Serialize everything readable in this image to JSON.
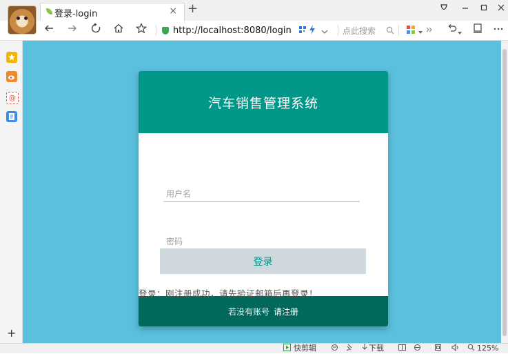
{
  "browser": {
    "tab_title": "登录-login",
    "tab_close": "×",
    "new_tab": "+",
    "address": "http://localhost:8080/login",
    "search_placeholder": "点此搜索",
    "zoom": "125%",
    "status": {
      "clip_label": "快剪辑",
      "download_label": "下载"
    }
  },
  "sidebar": {
    "add_label": "+"
  },
  "login": {
    "title": "汽车销售管理系统",
    "username_placeholder": "用户名",
    "password_placeholder": "密码",
    "submit_label": "登录",
    "message": "登录：刚注册成功，请先验证邮箱后再登录！",
    "no_account_text": "若没有账号",
    "register_link": "请注册"
  },
  "colors": {
    "page_bg": "#5bc0de",
    "header_bg": "#009688",
    "footer_bg": "#00695c",
    "button_bg": "#cfd8dc"
  }
}
